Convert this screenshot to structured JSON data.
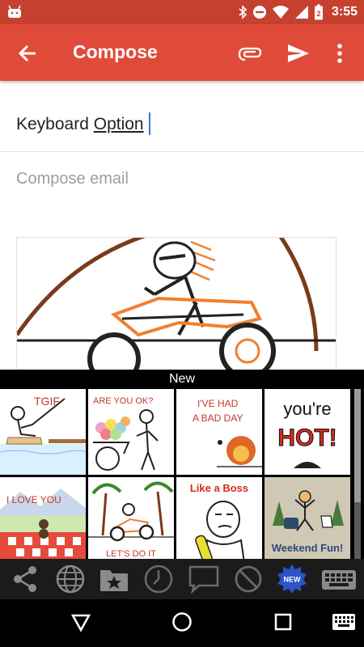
{
  "status_bar": {
    "time": "3:55",
    "battery_level": "2"
  },
  "app_bar": {
    "title": "Compose",
    "icons": [
      "back-arrow-icon",
      "paperclip-icon",
      "send-icon",
      "more-vert-icon"
    ]
  },
  "compose": {
    "subject_prefix": "Keyboard ",
    "subject_suffix": "Option",
    "body_placeholder": "Compose email"
  },
  "keyboard": {
    "section_title": "New",
    "stickers": [
      {
        "text": "TGIF"
      },
      {
        "text": "ARE YOU OK?"
      },
      {
        "line1": "I'VE HAD",
        "line2": "A BAD DAY"
      },
      {
        "line1": "you're",
        "line2": "HOT!"
      },
      {
        "text": "I LOVE YOU"
      },
      {
        "text": "LET'S DO IT"
      },
      {
        "text": "Like a Boss"
      },
      {
        "text": "Weekend Fun!"
      }
    ],
    "new_badge": "NEW",
    "toolbar_icons": [
      "share-icon",
      "globe-icon",
      "folder-star-icon",
      "clock-icon",
      "chat-bubble-icon",
      "block-icon",
      "new-badge-icon",
      "keyboard-icon"
    ]
  },
  "nav_bar": {
    "icons": [
      "back-icon",
      "home-icon",
      "recents-icon",
      "keyboard-switch-icon"
    ]
  },
  "colors": {
    "status_bar": "#c6402f",
    "app_bar": "#e04b39",
    "caret": "#3a78d8"
  }
}
